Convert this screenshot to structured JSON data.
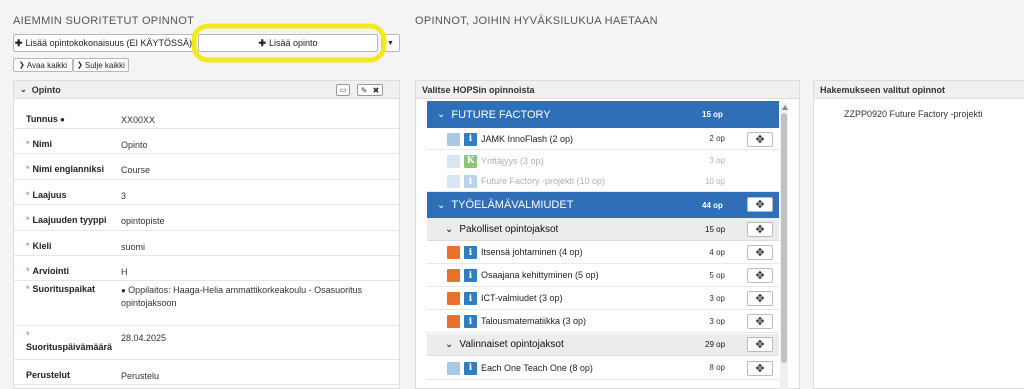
{
  "left": {
    "section_title": "AIEMMIN SUORITETUT OPINNOT",
    "add_kokonaisuus": "Lisää opintokokonaisuus (EI KÄYTÖSSÄ)",
    "add_opinto": "Lisää opinto",
    "open_all": "Avaa kaikki",
    "close_all": "Sulje kaikki",
    "card_title": "Opinto",
    "fields": [
      {
        "label": "Tunnus",
        "required": false,
        "value": "XX00XX"
      },
      {
        "label": "Nimi",
        "required": true,
        "value": "Opinto"
      },
      {
        "label": "Nimi englanniksi",
        "required": true,
        "value": "Course"
      },
      {
        "label": "Laajuus",
        "required": true,
        "value": "3"
      },
      {
        "label": "Laajuuden tyyppi",
        "required": true,
        "value": "opintopiste"
      },
      {
        "label": "Kieli",
        "required": true,
        "value": "suomi"
      },
      {
        "label": "Arviointi",
        "required": true,
        "value": "H"
      },
      {
        "label": "Suorituspaikat",
        "required": true,
        "value": "Oppilaitos: Haaga-Helia ammattikorkeakoulu - Osasuoritus opintojaksoon"
      },
      {
        "label": "Suorituspäivämäärä",
        "required": true,
        "value": "28.04.2025"
      },
      {
        "label": "Perustelut",
        "required": false,
        "value": "Perustelu"
      }
    ],
    "req_mark": "*"
  },
  "right": {
    "section_title": "OPINNOT, JOIHIN HYVÄKSILUKUA HAETAAN",
    "hops_title": "Valitse HOPSin opinnoista",
    "selected_title": "Hakemukseen valitut opinnot",
    "selected_items": [
      "ZZPP0920 Future Factory -projekti"
    ],
    "groups": {
      "future_factory": {
        "name": "FUTURE FACTORY",
        "op": "15 op"
      },
      "tyoelama": {
        "name": "TYÖELÄMÄVALMIUDET",
        "op": "44 op"
      },
      "pakolliset": {
        "name": "Pakolliset opintojaksot",
        "op": "15 op"
      },
      "valinnaiset": {
        "name": "Valinnaiset opintojaksot",
        "op": "29 op"
      }
    },
    "ff_items": [
      {
        "name": "JAMK InnoFlash (2 op)",
        "op": "2 op",
        "icon": "i"
      },
      {
        "name": "Yrittäjyys (3 op)",
        "op": "3 op",
        "icon": "K"
      },
      {
        "name": "Future Factory -projekti (10 op)",
        "op": "10 op",
        "icon": "i"
      }
    ],
    "pak_items": [
      {
        "name": "Itsensä johtaminen (4 op)",
        "op": "4 op",
        "icon": "i"
      },
      {
        "name": "Osaajana kehittyminen (5 op)",
        "op": "5 op",
        "icon": "i"
      },
      {
        "name": "ICT-valmiudet (3 op)",
        "op": "3 op",
        "icon": "i"
      },
      {
        "name": "Talousmatematiikka (3 op)",
        "op": "3 op",
        "icon": "i"
      }
    ],
    "val_items": [
      {
        "name": "Each One Teach One (8 op)",
        "op": "8 op",
        "icon": "i"
      }
    ]
  },
  "colors": {
    "accent_blue": "#2f6fb7",
    "highlight_yellow": "#f2ea1c",
    "orange": "#e8722c",
    "light_blue": "#a9c8e4",
    "green": "#8cc870"
  }
}
